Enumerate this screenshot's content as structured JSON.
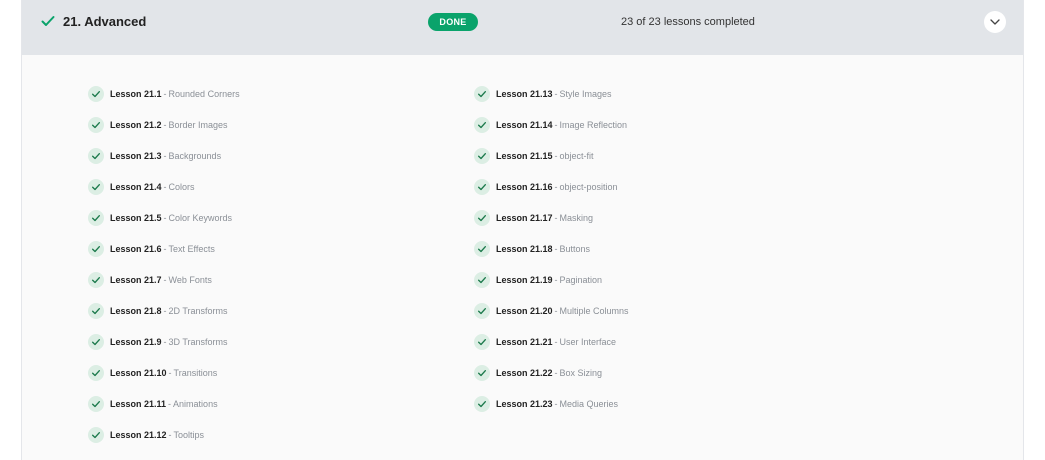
{
  "section": {
    "title": "21. Advanced",
    "status_badge": "DONE",
    "progress_text": "23 of 23 lessons completed",
    "toggle_icon": "chevron-down-icon",
    "check_icon": "check-icon",
    "accent_color": "#0aa36b"
  },
  "lesson_separator": "-",
  "columns": [
    [
      {
        "number": "Lesson 21.1",
        "name": "Rounded Corners"
      },
      {
        "number": "Lesson 21.2",
        "name": "Border Images"
      },
      {
        "number": "Lesson 21.3",
        "name": "Backgrounds"
      },
      {
        "number": "Lesson 21.4",
        "name": "Colors"
      },
      {
        "number": "Lesson 21.5",
        "name": "Color Keywords"
      },
      {
        "number": "Lesson 21.6",
        "name": "Text Effects"
      },
      {
        "number": "Lesson 21.7",
        "name": "Web Fonts"
      },
      {
        "number": "Lesson 21.8",
        "name": "2D Transforms"
      },
      {
        "number": "Lesson 21.9",
        "name": "3D Transforms"
      },
      {
        "number": "Lesson 21.10",
        "name": "Transitions"
      },
      {
        "number": "Lesson 21.11",
        "name": "Animations"
      },
      {
        "number": "Lesson 21.12",
        "name": "Tooltips"
      }
    ],
    [
      {
        "number": "Lesson 21.13",
        "name": "Style Images"
      },
      {
        "number": "Lesson 21.14",
        "name": "Image Reflection"
      },
      {
        "number": "Lesson 21.15",
        "name": "object-fit"
      },
      {
        "number": "Lesson 21.16",
        "name": "object-position"
      },
      {
        "number": "Lesson 21.17",
        "name": "Masking"
      },
      {
        "number": "Lesson 21.18",
        "name": "Buttons"
      },
      {
        "number": "Lesson 21.19",
        "name": "Pagination"
      },
      {
        "number": "Lesson 21.20",
        "name": "Multiple Columns"
      },
      {
        "number": "Lesson 21.21",
        "name": "User Interface"
      },
      {
        "number": "Lesson 21.22",
        "name": "Box Sizing"
      },
      {
        "number": "Lesson 21.23",
        "name": "Media Queries"
      }
    ]
  ]
}
